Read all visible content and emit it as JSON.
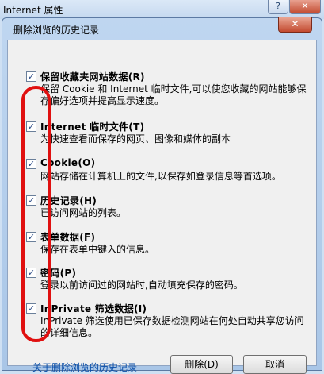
{
  "parent_window": {
    "title": "Internet 属性",
    "help_glyph": "?",
    "close_glyph": "✕"
  },
  "dialog": {
    "title": "删除浏览的历史记录",
    "close_glyph": "✕"
  },
  "options": [
    {
      "checked": true,
      "title": "保留收藏夹网站数据(R)",
      "desc": "保留 Cookie 和 Internet 临时文件,可以使您收藏的网站能够保存偏好选项并提高显示速度。"
    },
    {
      "checked": true,
      "title": "Internet 临时文件(T)",
      "desc": "为快速查看而保存的网页、图像和媒体的副本"
    },
    {
      "checked": true,
      "title": "Cookie(O)",
      "desc": "网站存储在计算机上的文件,以保存如登录信息等首选项。"
    },
    {
      "checked": true,
      "title": "历史记录(H)",
      "desc": "已访问网站的列表。"
    },
    {
      "checked": true,
      "title": "表单数据(F)",
      "desc": "保存在表单中键入的信息。"
    },
    {
      "checked": true,
      "title": "密码(P)",
      "desc": "登录以前访问过的网站时,自动填充保存的密码。"
    },
    {
      "checked": true,
      "title": "InPrivate 筛选数据(I)",
      "desc": "InPrivate 筛选使用已保存数据检测网站在何处自动共享您访问的详细信息。"
    }
  ],
  "footer": {
    "link": "关于删除浏览的历史记录",
    "delete_label": "删除(D)",
    "cancel_label": "取消"
  },
  "colors": {
    "annotation_red": "#e01010",
    "link_blue": "#0a4ea8"
  }
}
